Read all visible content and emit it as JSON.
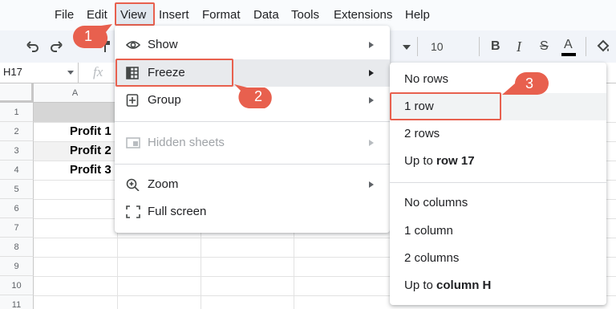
{
  "menubar": {
    "items": [
      "File",
      "Edit",
      "View",
      "Insert",
      "Format",
      "Data",
      "Tools",
      "Extensions",
      "Help"
    ]
  },
  "toolbar": {
    "font_size": "10",
    "bold": "B",
    "italic": "I",
    "strike": "S",
    "text_color": "A"
  },
  "formula_bar": {
    "name_box": "H17",
    "fx": "fx"
  },
  "grid": {
    "column_headers": [
      "A"
    ],
    "row_numbers": [
      "1",
      "2",
      "3",
      "4",
      "5",
      "6",
      "7",
      "8",
      "9",
      "10",
      "11"
    ],
    "cells": [
      "Profit 1",
      "Profit 2",
      "Profit 3"
    ]
  },
  "view_menu": {
    "items": [
      {
        "label": "Show",
        "icon": "eye-icon"
      },
      {
        "label": "Freeze",
        "icon": "freeze-grid-icon"
      },
      {
        "label": "Group",
        "icon": "plus-box-icon"
      },
      {
        "label": "Hidden sheets",
        "icon": "hidden-sheet-icon"
      },
      {
        "label": "Zoom",
        "icon": "zoom-icon"
      },
      {
        "label": "Full screen",
        "icon": "fullscreen-icon"
      }
    ]
  },
  "freeze_submenu": {
    "no_rows": "No rows",
    "one_row": "1 row",
    "two_rows": "2 rows",
    "up_to_row_prefix": "Up to ",
    "up_to_row_bold": "row 17",
    "no_columns": "No columns",
    "one_column": "1 column",
    "two_columns": "2 columns",
    "up_to_col_prefix": "Up to ",
    "up_to_col_bold": "column H"
  },
  "callouts": [
    "1",
    "2",
    "3"
  ],
  "colors": {
    "highlight": "#e8604e",
    "callout": "#e8604e",
    "menu_bg": "#f9fbfd"
  }
}
